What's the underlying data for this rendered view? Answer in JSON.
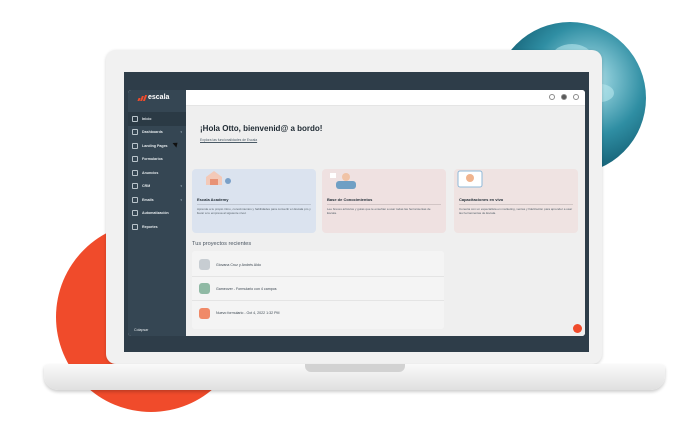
{
  "app": {
    "brand": "escala",
    "nav": [
      {
        "label": "Inicio",
        "icon": "home-icon",
        "active": true,
        "chevron": false
      },
      {
        "label": "Dashboards",
        "icon": "dashboard-icon",
        "active": false,
        "chevron": true
      },
      {
        "label": "Landing Pages",
        "icon": "landing-page-icon",
        "active": false,
        "chevron": false
      },
      {
        "label": "Formularios",
        "icon": "form-icon",
        "active": false,
        "chevron": false
      },
      {
        "label": "Anuncios",
        "icon": "ads-icon",
        "active": false,
        "chevron": false
      },
      {
        "label": "CRM",
        "icon": "crm-icon",
        "active": false,
        "chevron": true
      },
      {
        "label": "Emails",
        "icon": "email-icon",
        "active": false,
        "chevron": true
      },
      {
        "label": "Automatización",
        "icon": "automation-icon",
        "active": false,
        "chevron": false
      },
      {
        "label": "Reportes",
        "icon": "reports-icon",
        "active": false,
        "chevron": false
      }
    ],
    "collapse_label": "Colapsar"
  },
  "main": {
    "greeting": "¡Hola Otto, bienvenid@ a bordo!",
    "explore_link": "Explora las funcionalidades de Escala",
    "cards": [
      {
        "title": "Escala Academy",
        "desc": "Aprende a tu propio ritmo, conocimientos y habilidades para convertir en Escala pro y llevar a tu empresa al siguiente nivel."
      },
      {
        "title": "Base de Conocimientos",
        "desc": "Lee breves artículos y guías que te enseñan a usar todas las herramientas de Escala."
      },
      {
        "title": "Capacitaciones en vivo",
        "desc": "Conecta con un especialista en marketing, ventas y fidelización para aprender a usar las herramientas de Escala."
      }
    ],
    "projects_title": "Tus proyectos recientes",
    "projects": [
      {
        "name": "Giovana Cruz y Andrés Aldo",
        "icon": "contact-icon",
        "color": "#c7cdd2"
      },
      {
        "name": "Gameover - Formulario con 4 campos",
        "icon": "form-icon",
        "color": "#8fb9a4"
      },
      {
        "name": "Nuevo formulario - Oct 4, 2022 1:32 PM",
        "icon": "form-icon",
        "color": "#f08a68"
      }
    ]
  },
  "colors": {
    "accent": "#f04b2b",
    "sidebar": "#354653",
    "planet": "#2f8ea3"
  }
}
